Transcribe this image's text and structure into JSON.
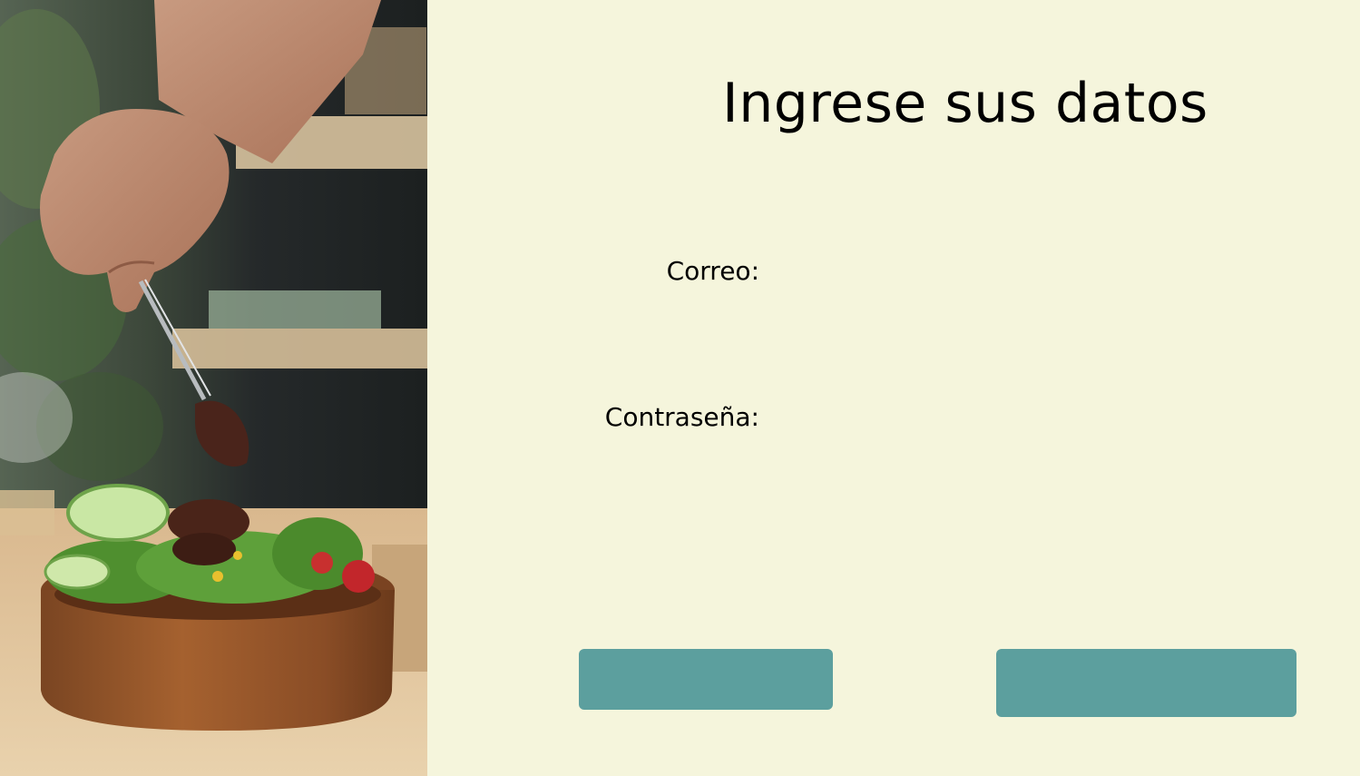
{
  "colors": {
    "page_background": "#f5f5dc",
    "button_background": "#5c9f9e",
    "text": "#000000"
  },
  "hero_image": {
    "icon": "chef-plating-salad-photo"
  },
  "form": {
    "title": "Ingrese sus datos",
    "email_label": "Correo:",
    "email_value": "",
    "password_label": "Contraseña:",
    "password_value": ""
  },
  "buttons": {
    "left_label": "",
    "right_label": ""
  }
}
